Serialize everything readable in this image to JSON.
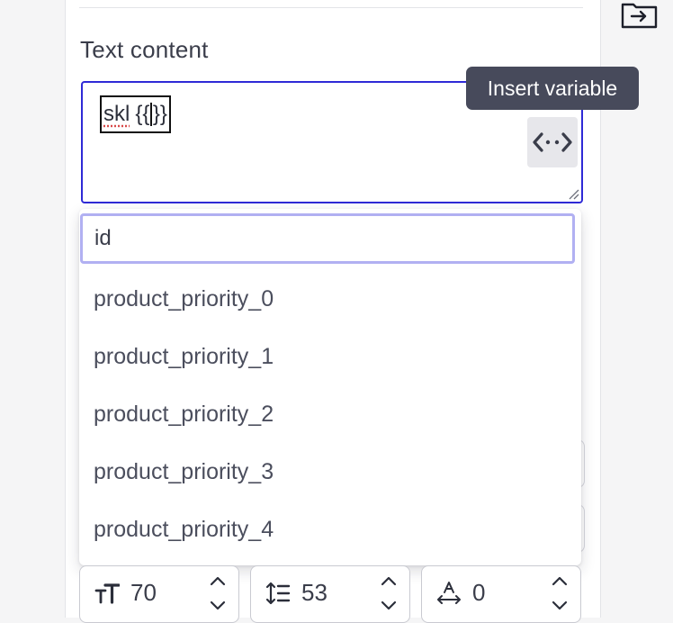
{
  "editor": {
    "section_label": "Text content",
    "text_value_word": "skl",
    "text_value_braces_open": "{{",
    "text_value_braces_close": "}}",
    "insert_button_tooltip": "Insert variable"
  },
  "variable_dropdown": {
    "search_value": "id",
    "options": [
      "product_priority_0",
      "product_priority_1",
      "product_priority_2",
      "product_priority_3",
      "product_priority_4"
    ]
  },
  "typography_controls": {
    "font_size": "70",
    "line_height": "53",
    "letter_spacing": "0"
  },
  "icons": {
    "export": "export-to-folder-icon",
    "insert_variable": "code-brackets-icon",
    "font_size": "font-size-icon",
    "line_height": "line-height-icon",
    "letter_spacing": "letter-spacing-icon",
    "chevron_up": "chevron-up-icon",
    "chevron_down": "chevron-down-icon"
  },
  "colors": {
    "accent": "#2f2ad6",
    "input_focus": "#b1b0f2",
    "tooltip_bg": "#474a5b"
  }
}
